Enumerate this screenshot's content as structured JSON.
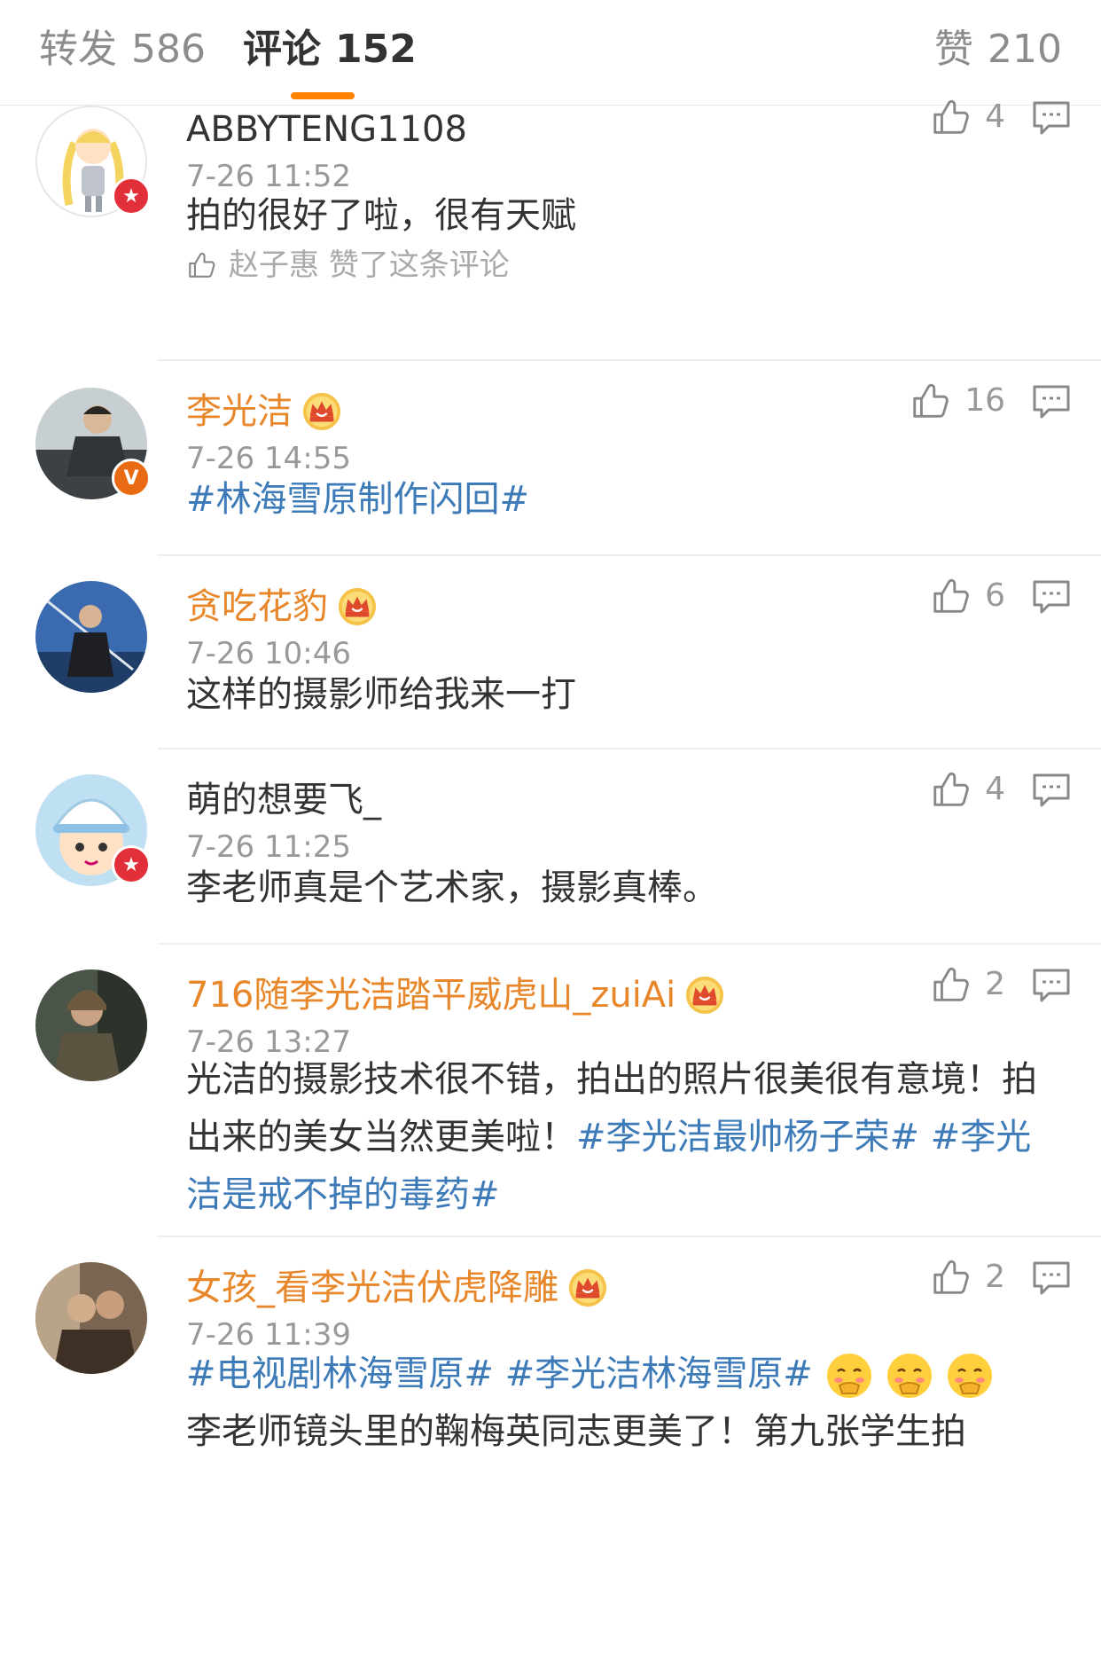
{
  "tabs": {
    "reposts": {
      "label": "转发",
      "count": "586"
    },
    "comments": {
      "label": "评论",
      "count": "152"
    },
    "likes": {
      "label": "赞",
      "count": "210"
    }
  },
  "accent_color": "#ff8200",
  "link_color": "#3d7ab8",
  "vip_name_color": "#e8862a",
  "comments": [
    {
      "username": "ABBYTENG1108",
      "vip": false,
      "badge": "star",
      "time": "7-26 11:52",
      "likes": "4",
      "text": "拍的很好了啦，很有天赋",
      "liked_by": "赵子惠 赞了这条评论"
    },
    {
      "username": "李光洁",
      "vip": true,
      "badge": "V",
      "time": "7-26 14:55",
      "likes": "16",
      "text": "#林海雪原制作闪回#"
    },
    {
      "username": "贪吃花豹",
      "vip": true,
      "time": "7-26 10:46",
      "likes": "6",
      "text": "这样的摄影师给我来一打"
    },
    {
      "username": "萌的想要飞_",
      "vip": false,
      "badge": "star",
      "time": "7-26 11:25",
      "likes": "4",
      "text": "李老师真是个艺术家，摄影真棒。"
    },
    {
      "username": "716随李光洁踏平威虎山_zuiAi",
      "vip": true,
      "time": "7-26 13:27",
      "likes": "2",
      "text_plain": "光洁的摄影技术很不错，拍出的照片很美很有意境！拍出来的美女当然更美啦！",
      "tag_1": "#李光洁最帅杨子荣#",
      "tag_2": "#李光洁是戒不掉的毒药#"
    },
    {
      "username": "女孩_看李光洁伏虎降雕",
      "vip": true,
      "time": "7-26 11:39",
      "likes": "2",
      "tag_1": "#电视剧林海雪原#",
      "tag_2": "#李光洁林海雪原#",
      "emoji_name": "shy-face-emoji",
      "text_cutoff": "李老师镜头里的鞠梅英同志更美了！第九张学生拍"
    }
  ]
}
